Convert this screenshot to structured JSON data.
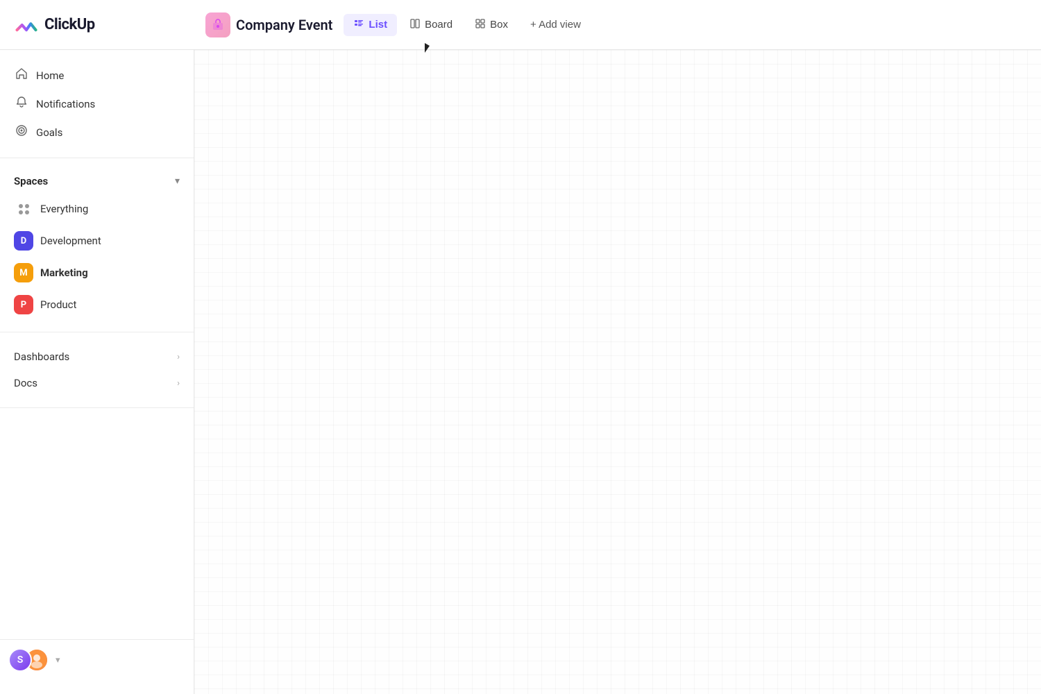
{
  "logo": {
    "text": "ClickUp"
  },
  "topbar": {
    "project_icon_emoji": "📦",
    "project_title": "Company Event",
    "views": [
      {
        "id": "list",
        "label": "List",
        "icon": "☰",
        "active": true
      },
      {
        "id": "board",
        "label": "Board",
        "icon": "⊞",
        "active": false
      },
      {
        "id": "box",
        "label": "Box",
        "icon": "⊟",
        "active": false
      }
    ],
    "add_view_label": "+ Add view"
  },
  "sidebar": {
    "nav_items": [
      {
        "id": "home",
        "label": "Home",
        "icon": "⌂"
      },
      {
        "id": "notifications",
        "label": "Notifications",
        "icon": "🔔"
      },
      {
        "id": "goals",
        "label": "Goals",
        "icon": "🏆"
      }
    ],
    "spaces_label": "Spaces",
    "spaces": [
      {
        "id": "everything",
        "label": "Everything",
        "type": "everything"
      },
      {
        "id": "development",
        "label": "Development",
        "type": "badge",
        "badge_letter": "D",
        "badge_class": "badge-development",
        "bold": false
      },
      {
        "id": "marketing",
        "label": "Marketing",
        "type": "badge",
        "badge_letter": "M",
        "badge_class": "badge-marketing",
        "bold": true
      },
      {
        "id": "product",
        "label": "Product",
        "type": "badge",
        "badge_letter": "P",
        "badge_class": "badge-product",
        "bold": false
      }
    ],
    "collapsible_items": [
      {
        "id": "dashboards",
        "label": "Dashboards"
      },
      {
        "id": "docs",
        "label": "Docs"
      }
    ],
    "user_chevron": "▾"
  }
}
